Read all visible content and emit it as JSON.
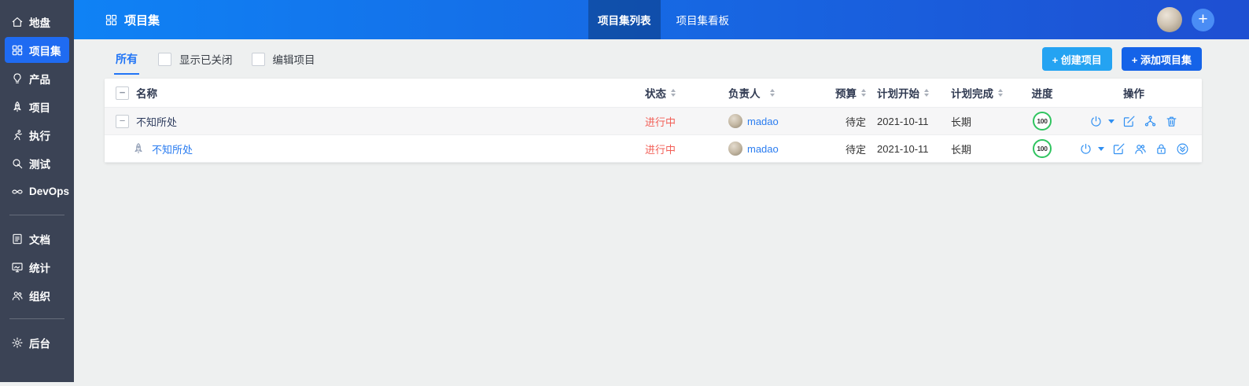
{
  "colors": {
    "topbar_gradient_start": "#0f82f5",
    "topbar_gradient_end": "#1e4fd2",
    "sidebar_bg": "#3b4355",
    "sidebar_active_bg": "#1f6bf2",
    "link_blue": "#2a7cf0",
    "status_doing_red": "#f25f57",
    "progress_ring_green": "#2fc45f",
    "action_icon_blue": "#2f8ff2",
    "create_project_button_bg": "#24a3f2",
    "add_program_button_bg": "#1563e8"
  },
  "sidebar": {
    "items": [
      {
        "label": "地盘",
        "icon": "home-icon",
        "active": false
      },
      {
        "label": "项目集",
        "icon": "program-grid-icon",
        "active": true
      },
      {
        "label": "产品",
        "icon": "product-bulb-icon",
        "active": false
      },
      {
        "label": "项目",
        "icon": "project-rocket-icon",
        "active": false
      },
      {
        "label": "执行",
        "icon": "execution-runner-icon",
        "active": false
      },
      {
        "label": "测试",
        "icon": "test-magnifier-icon",
        "active": false
      },
      {
        "label": "DevOps",
        "icon": "devops-infinity-icon",
        "active": false
      },
      {
        "label": "文档",
        "icon": "doc-icon",
        "active": false
      },
      {
        "label": "统计",
        "icon": "stats-monitor-icon",
        "active": false
      },
      {
        "label": "组织",
        "icon": "org-people-icon",
        "active": false
      },
      {
        "label": "后台",
        "icon": "admin-gear-icon",
        "active": false
      }
    ]
  },
  "header": {
    "title": "项目集",
    "tabs": [
      {
        "label": "项目集列表",
        "active": true
      },
      {
        "label": "项目集看板",
        "active": false
      }
    ]
  },
  "toolbar": {
    "filter_all_label": "所有",
    "show_closed_label": "显示已关闭",
    "edit_project_label": "编辑项目",
    "create_project_label": "+ 创建项目",
    "add_program_label": "+ 添加项目集"
  },
  "table": {
    "columns": [
      {
        "label": "名称",
        "sortable": false
      },
      {
        "label": "状态",
        "sortable": true
      },
      {
        "label": "负责人",
        "sortable": true
      },
      {
        "label": "预算",
        "sortable": true
      },
      {
        "label": "计划开始",
        "sortable": true
      },
      {
        "label": "计划完成",
        "sortable": true
      },
      {
        "label": "进度",
        "sortable": false
      },
      {
        "label": "操作",
        "sortable": false
      }
    ],
    "rows": [
      {
        "name": "不知所处",
        "level": "program",
        "status": "进行中",
        "owner": "madao",
        "budget": "待定",
        "plan_begin": "2021-10-11",
        "plan_end": "长期",
        "progress": "100",
        "actions": [
          "power",
          "caret-down",
          "edit",
          "split",
          "delete"
        ]
      },
      {
        "name": "不知所处",
        "level": "project",
        "status": "进行中",
        "owner": "madao",
        "budget": "待定",
        "plan_begin": "2021-10-11",
        "plan_end": "长期",
        "progress": "100",
        "actions": [
          "power",
          "caret-down",
          "edit",
          "team",
          "lock",
          "more"
        ]
      }
    ]
  }
}
